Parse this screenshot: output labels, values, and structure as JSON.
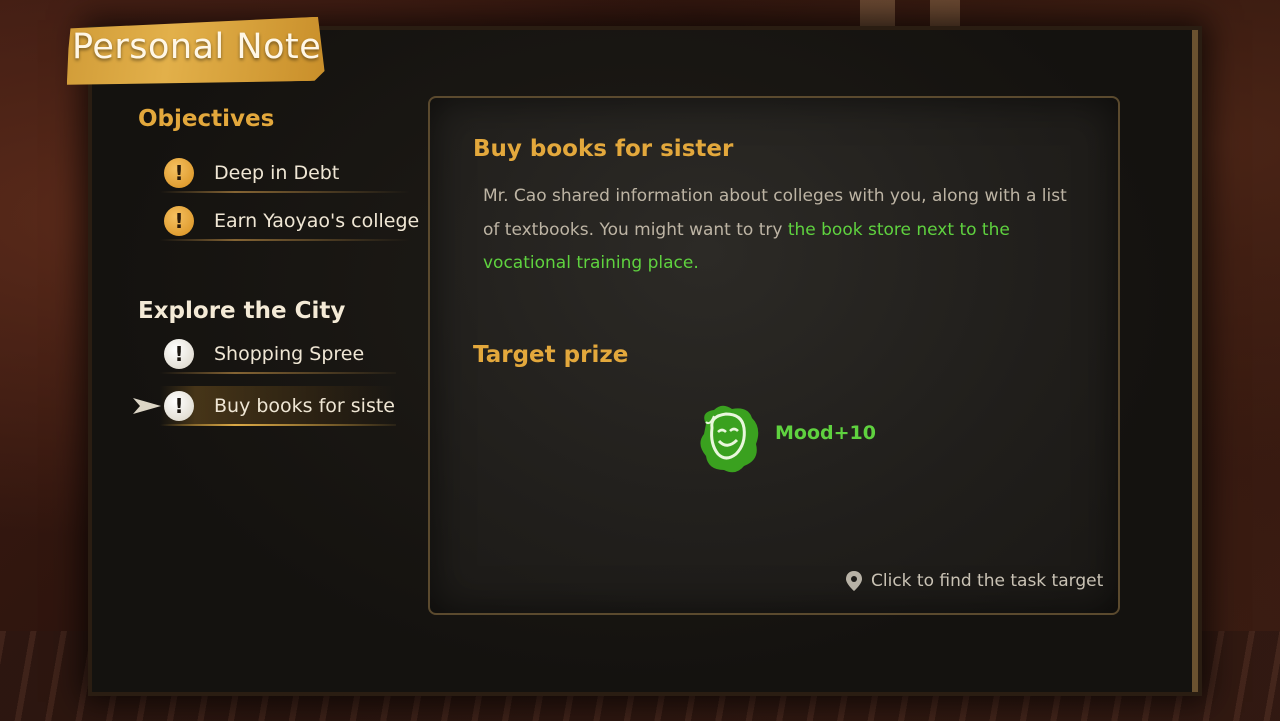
{
  "window": {
    "title": "Personal Note"
  },
  "objectives": {
    "heading": "Objectives",
    "items": [
      {
        "label": "Deep in Debt",
        "icon": "exclamation-icon"
      },
      {
        "label": "Earn Yaoyao's college",
        "icon": "exclamation-icon"
      }
    ]
  },
  "explore": {
    "heading": "Explore the City",
    "items": [
      {
        "label": "Shopping Spree",
        "icon": "exclamation-icon"
      },
      {
        "label": "Buy books for sister",
        "icon": "exclamation-icon",
        "selected": true
      }
    ]
  },
  "detail": {
    "title": "Buy books for sister",
    "desc_plain": "Mr. Cao shared information about colleges with you, along with a list of textbooks. You might want to try ",
    "desc_highlight": "the book store next to the vocational training place.",
    "prize_heading": "Target prize",
    "prize_value": "Mood+10",
    "find_target_label": "Click to find the task target"
  },
  "colors": {
    "accent_orange": "#e3a83c",
    "highlight_green": "#5fd23f",
    "panel_bg": "#15130f"
  }
}
